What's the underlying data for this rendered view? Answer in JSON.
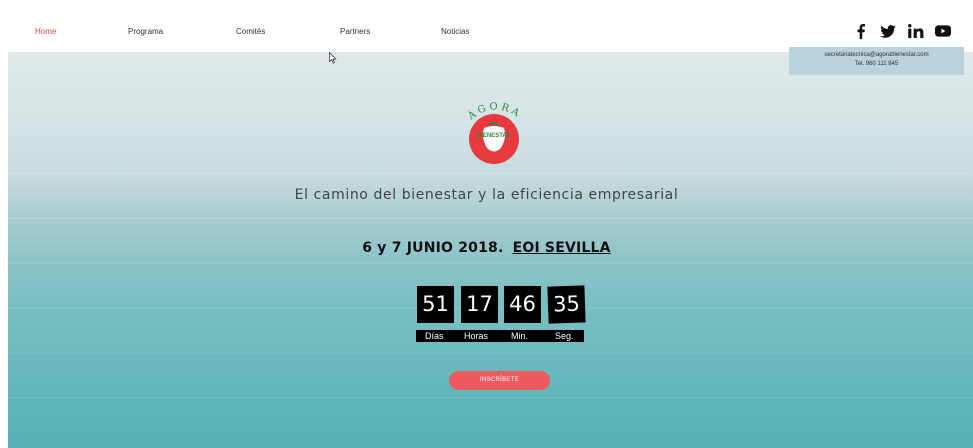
{
  "nav": {
    "items": [
      {
        "label": "Home",
        "active": true
      },
      {
        "label": "Programa"
      },
      {
        "label": "Comités"
      },
      {
        "label": "Partners"
      },
      {
        "label": "Noticias"
      }
    ],
    "social": [
      "facebook-icon",
      "twitter-icon",
      "linkedin-icon",
      "youtube-icon"
    ]
  },
  "contact": {
    "email": "secretariatecnica@agorabienestar.com",
    "phone": "Tel. 960 111 845"
  },
  "logo": {
    "top_text": "ÁGORA",
    "badge_text": "BIENESTAR"
  },
  "hero": {
    "tagline": "El camino del bienestar y la eficiencia empresarial",
    "event_date": "6 y 7 JUNIO 2018.",
    "event_venue": "EOI SEVILLA"
  },
  "countdown": {
    "days": "51",
    "hours": "17",
    "minutes": "46",
    "seconds": "35",
    "labels": {
      "days": "Días",
      "hours": "Horas",
      "minutes": "Min.",
      "seconds": "Seg."
    }
  },
  "cta": {
    "label": "INSCRÍBETE"
  },
  "colors": {
    "accent": "#ee5a5f",
    "nav_active": "#e0474c",
    "contact_bg": "#b9d2dc",
    "logo_red": "#e63a3f",
    "logo_green": "#2f8a3e"
  }
}
